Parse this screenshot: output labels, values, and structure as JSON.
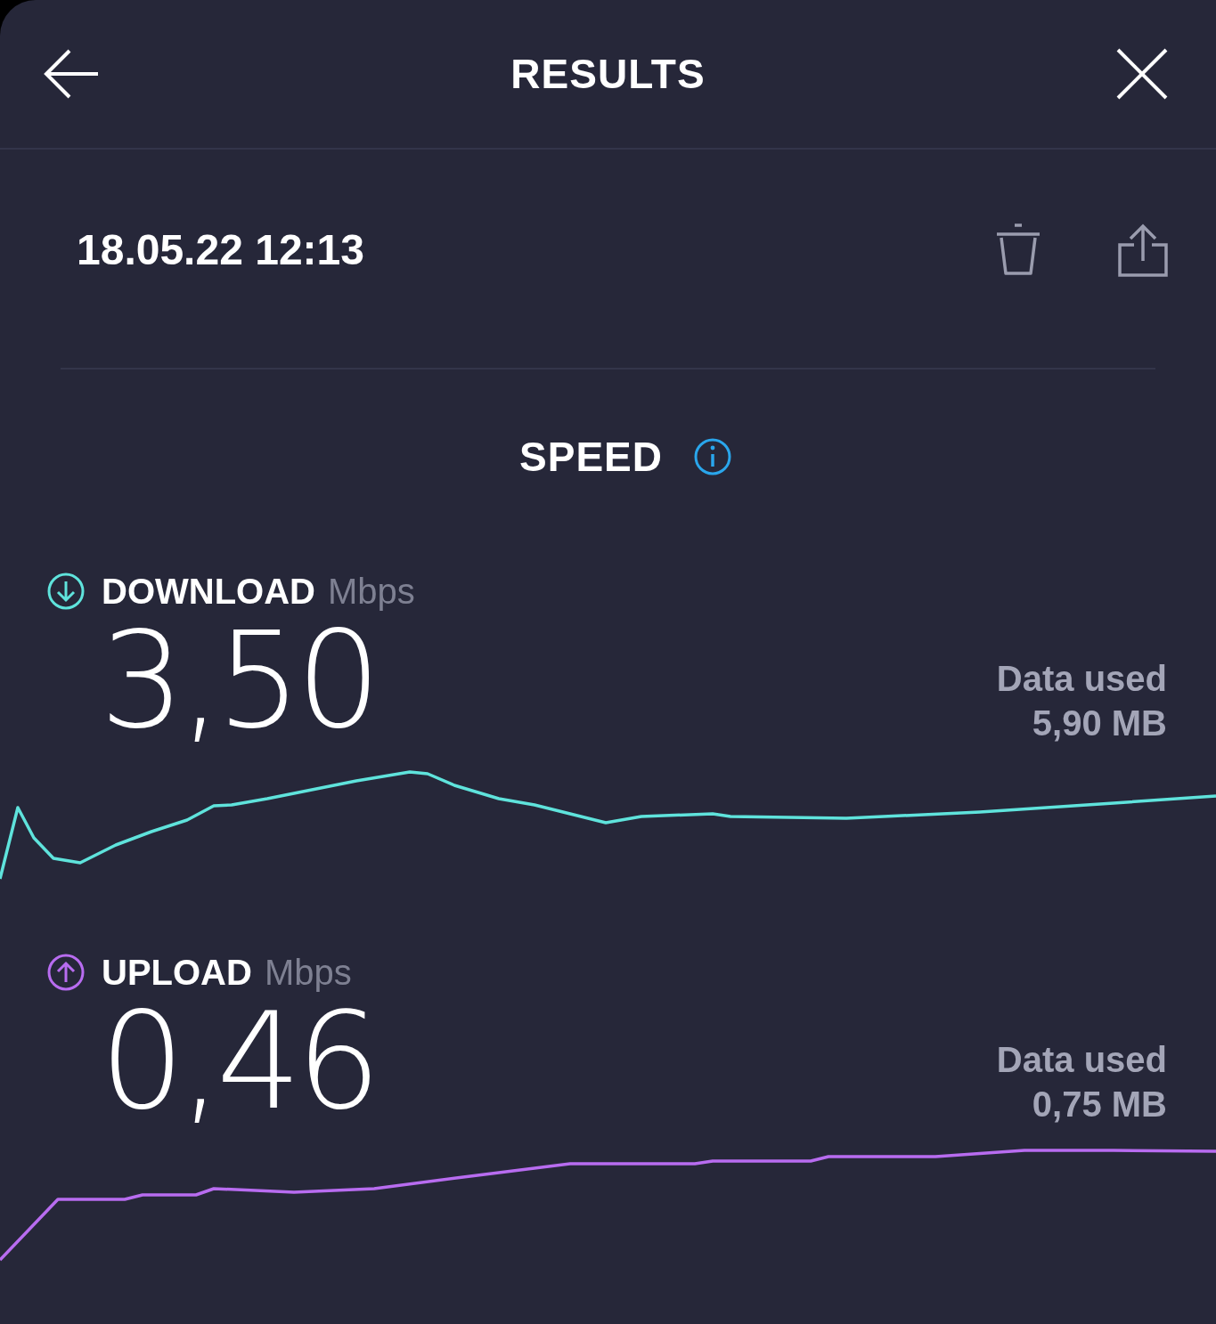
{
  "header": {
    "title": "RESULTS"
  },
  "result": {
    "timestamp": "18.05.22 12:13"
  },
  "section": {
    "title": "SPEED"
  },
  "measurements": [
    {
      "kind": "download",
      "label": "DOWNLOAD",
      "unit": "Mbps",
      "value": "3,50",
      "data_label": "Data used",
      "data_value": "5,90 MB"
    },
    {
      "kind": "upload",
      "label": "UPLOAD",
      "unit": "Mbps",
      "value": "0,46",
      "data_label": "Data used",
      "data_value": "0,75 MB"
    }
  ]
}
